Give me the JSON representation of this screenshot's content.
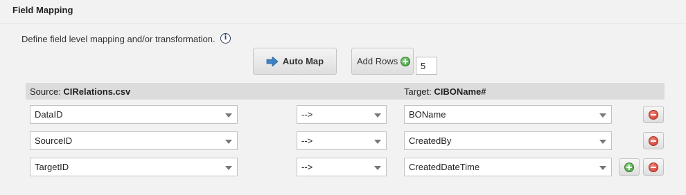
{
  "section": {
    "title": "Field Mapping",
    "description": "Define field level mapping and/or transformation.",
    "info_icon": "i"
  },
  "toolbar": {
    "auto_map_label": "Auto Map",
    "add_rows_label": "Add Rows",
    "rows_count": "5"
  },
  "header": {
    "source_prefix": "Source: ",
    "source_name": "CIRelations.csv",
    "target_prefix": "Target: ",
    "target_name": "CIBOName#"
  },
  "rows": [
    {
      "source": "DataID",
      "operator": "-->",
      "target": "BOName"
    },
    {
      "source": "SourceID",
      "operator": "-->",
      "target": "CreatedBy"
    },
    {
      "source": "TargetID",
      "operator": "-->",
      "target": "CreatedDateTime"
    }
  ],
  "colors": {
    "background": "#f2f2f2",
    "header_bar": "#dcdcdc",
    "add_green": "#3f9a3a",
    "remove_red": "#c8352a",
    "arrow_blue": "#3c82c4"
  }
}
